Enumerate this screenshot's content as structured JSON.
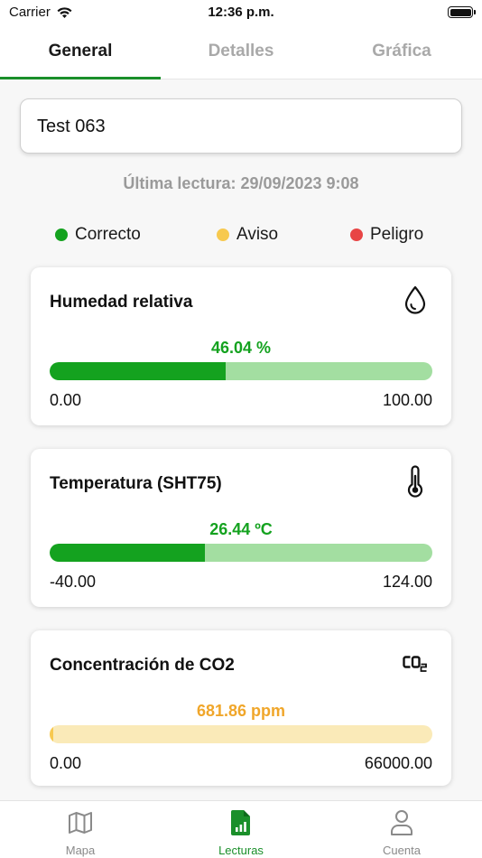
{
  "status_bar": {
    "carrier": "Carrier",
    "time": "12:36 p.m."
  },
  "tabs": [
    {
      "label": "General",
      "active": true
    },
    {
      "label": "Detalles",
      "active": false
    },
    {
      "label": "Gráfica",
      "active": false
    }
  ],
  "device": {
    "name": "Test 063"
  },
  "last_reading": "Última lectura: 29/09/2023 9:08",
  "legend": [
    {
      "label": "Correcto",
      "color": "#14a21f"
    },
    {
      "label": "Aviso",
      "color": "#f7c94f"
    },
    {
      "label": "Peligro",
      "color": "#e84545"
    }
  ],
  "cards": [
    {
      "title": "Humedad relativa",
      "icon": "water-drop-icon",
      "value_text": "46.04 %",
      "value_color": "#14a21f",
      "min_label": "0.00",
      "max_label": "100.00",
      "progress": 0.4604,
      "fill_color": "#14a21f",
      "track_color": "#a3dea1"
    },
    {
      "title": "Temperatura (SHT75)",
      "icon": "thermometer-icon",
      "value_text": "26.44 ºC",
      "value_color": "#14a21f",
      "min_label": "-40.00",
      "max_label": "124.00",
      "progress": 0.4051,
      "fill_color": "#14a21f",
      "track_color": "#a3dea1"
    },
    {
      "title": "Concentración de CO2",
      "icon": "co2-icon",
      "value_text": "681.86 ppm",
      "value_color": "#f0a62a",
      "min_label": "0.00",
      "max_label": "66000.00",
      "progress": 0.0103,
      "fill_color": "#f7c94f",
      "track_color": "#faeab8"
    }
  ],
  "bottom_nav": [
    {
      "label": "Mapa",
      "icon": "map-icon",
      "active": false
    },
    {
      "label": "Lecturas",
      "icon": "readings-document-icon",
      "active": true
    },
    {
      "label": "Cuenta",
      "icon": "user-icon",
      "active": false
    }
  ]
}
